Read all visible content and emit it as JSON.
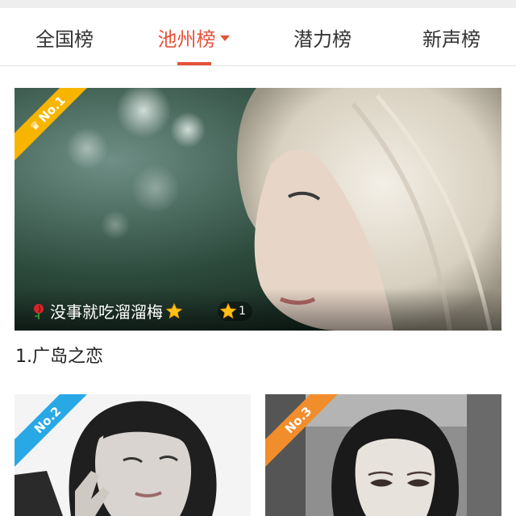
{
  "tabs": [
    {
      "label": "全国榜",
      "active": false
    },
    {
      "label": "池州榜",
      "active": true
    },
    {
      "label": "潜力榜",
      "active": false
    },
    {
      "label": "新声榜",
      "active": false
    }
  ],
  "cards": [
    {
      "rank_badge": "No.1",
      "badge_color": "#f7b500",
      "singer": "没事就吃溜溜梅",
      "level": "1",
      "title": "1.广岛之恋"
    },
    {
      "rank_badge": "No.2",
      "badge_color": "#29a8e6"
    },
    {
      "rank_badge": "No.3",
      "badge_color": "#f28d2c"
    }
  ],
  "colors": {
    "accent": "#e6533c"
  }
}
